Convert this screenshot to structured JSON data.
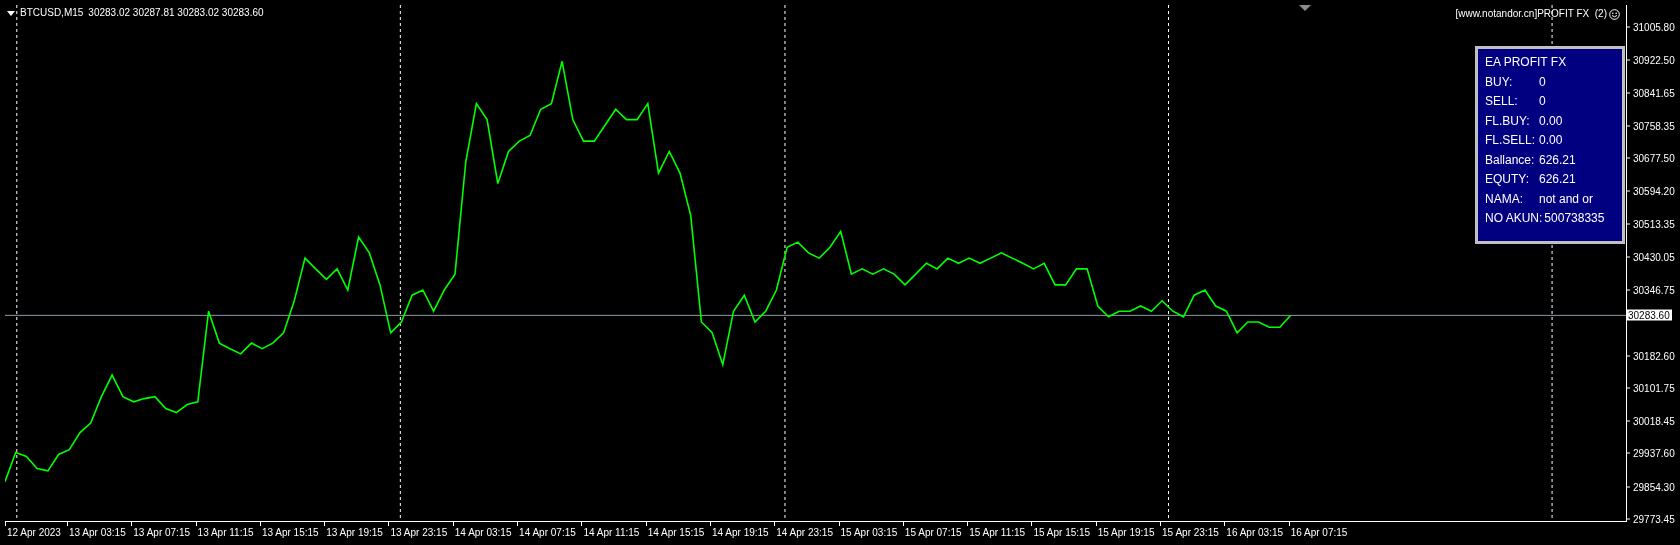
{
  "chart": {
    "header": {
      "symbol": "BTCUSD,M15",
      "quotes": "30283.02 30287.81 30283.02 30283.60"
    },
    "time_axis_labels": [
      "12 Apr 2023",
      "13 Apr 03:15",
      "13 Apr 07:15",
      "13 Apr 11:15",
      "13 Apr 15:15",
      "13 Apr 19:15",
      "13 Apr 23:15",
      "14 Apr 03:15",
      "14 Apr 07:15",
      "14 Apr 11:15",
      "14 Apr 15:15",
      "14 Apr 19:15",
      "14 Apr 23:15",
      "15 Apr 03:15",
      "15 Apr 07:15",
      "15 Apr 11:15",
      "15 Apr 15:15",
      "15 Apr 19:15",
      "15 Apr 23:15",
      "16 Apr 03:15",
      "16 Apr 07:15"
    ],
    "expert_label": {
      "text": "[www.notandor.cn]PROFIT FX  (2)"
    },
    "info_panel": {
      "title": "EA PROFIT FX",
      "rows": [
        {
          "label": "BUY:",
          "value": "0"
        },
        {
          "label": "SELL:",
          "value": "0"
        },
        {
          "label": "FL.BUY:",
          "value": "0.00"
        },
        {
          "label": "FL.SELL:",
          "value": "0.00"
        },
        {
          "label": "Ballance:",
          "value": "626.21"
        },
        {
          "label": "EQUTY:",
          "value": "626.21"
        },
        {
          "label": "NAMA:",
          "value": "not and or"
        },
        {
          "label": "NO AKUN:",
          "value": "500738335"
        }
      ]
    },
    "chart_data": {
      "type": "line",
      "ylim": [
        29766,
        31061
      ],
      "series": [
        {
          "color": "#00ff00",
          "values": [
            29867,
            29940,
            29930,
            29900,
            29894,
            29935,
            29947,
            29990,
            30014,
            30080,
            30134,
            30080,
            30067,
            30075,
            30080,
            30050,
            30040,
            30060,
            30067,
            30294,
            30214,
            30200,
            30187,
            30214,
            30200,
            30214,
            30240,
            30320,
            30427,
            30400,
            30374,
            30400,
            30347,
            30480,
            30440,
            30360,
            30240,
            30267,
            30334,
            30347,
            30294,
            30347,
            30387,
            30667,
            30814,
            30774,
            30614,
            30694,
            30720,
            30734,
            30800,
            30814,
            30920,
            30774,
            30720,
            30720,
            30760,
            30800,
            30774,
            30774,
            30814,
            30640,
            30694,
            30640,
            30534,
            30267,
            30240,
            30160,
            30294,
            30334,
            30267,
            30294,
            30347,
            30454,
            30467,
            30440,
            30427,
            30454,
            30494,
            30387,
            30400,
            30387,
            30400,
            30387,
            30360,
            30387,
            30414,
            30400,
            30427,
            30414,
            30427,
            30414,
            30427,
            30440,
            30427,
            30414,
            30400,
            30414,
            30360,
            30360,
            30400,
            30400,
            30307,
            30280,
            30294,
            30294,
            30307,
            30294,
            30320,
            30294,
            30280,
            30334,
            30347,
            30307,
            30294,
            30240,
            30267,
            30267,
            30254,
            30254,
            30284
          ]
        }
      ],
      "yticks": [
        {
          "value": 31005.8,
          "label": "31005.80"
        },
        {
          "value": 30922.5,
          "label": "30922.50"
        },
        {
          "value": 30841.65,
          "label": "30841.65"
        },
        {
          "value": 30758.35,
          "label": "30758.35"
        },
        {
          "value": 30677.5,
          "label": "30677.50"
        },
        {
          "value": 30594.2,
          "label": "30594.20"
        },
        {
          "value": 30513.35,
          "label": "30513.35"
        },
        {
          "value": 30430.05,
          "label": "30430.05"
        },
        {
          "value": 30346.75,
          "label": "30346.75"
        },
        {
          "value": 30182.6,
          "label": "30182.60"
        },
        {
          "value": 30101.75,
          "label": "30101.75"
        },
        {
          "value": 30018.45,
          "label": "30018.45"
        },
        {
          "value": 29937.6,
          "label": "29937.60"
        },
        {
          "value": 29854.3,
          "label": "29854.30"
        },
        {
          "value": 29773.45,
          "label": "29773.45"
        }
      ],
      "ref_lines": [
        {
          "axis": "y",
          "value": 30283.6,
          "label": "30283.60"
        }
      ]
    }
  }
}
